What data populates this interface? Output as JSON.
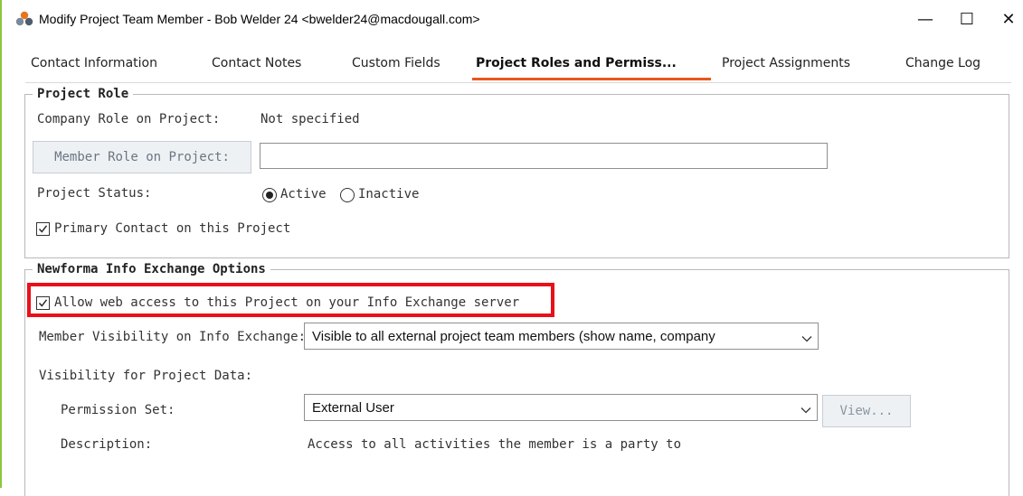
{
  "window": {
    "title": "Modify Project Team Member - Bob Welder 24 <bwelder24@macdougall.com>",
    "controls": {
      "minimize": "—",
      "maximize": "☐",
      "close": "✕"
    }
  },
  "tabs": [
    {
      "label": "Contact Information"
    },
    {
      "label": "Contact Notes"
    },
    {
      "label": "Custom Fields"
    },
    {
      "label": "Project Roles and Permiss..."
    },
    {
      "label": "Project Assignments"
    },
    {
      "label": "Change Log"
    }
  ],
  "active_tab": "Project Roles and Permiss...",
  "project_role": {
    "legend": "Project Role",
    "company_role_label": "Company Role on Project:",
    "company_role_value": "Not specified",
    "member_role_button": "Member Role on Project:",
    "member_role_value": "",
    "status_label": "Project Status:",
    "status_active": "Active",
    "status_inactive": "Inactive",
    "status_selected": "Active",
    "primary_contact_label": "Primary Contact on this Project",
    "primary_contact_checked": true
  },
  "info_exchange": {
    "legend": "Newforma Info Exchange Options",
    "allow_web_access_label": "Allow web access to this Project on your Info Exchange server",
    "allow_web_access_checked": true,
    "member_visibility_label": "Member Visibility on Info Exchange:",
    "member_visibility_value": "Visible to all external project team members (show name, company",
    "visibility_data_label": "Visibility for Project Data:",
    "permission_set_label": "Permission Set:",
    "permission_set_value": "External User",
    "view_button": "View...",
    "description_label": "Description:",
    "description_value": "Access to all activities the member is a party to"
  },
  "colors": {
    "tab_accent": "#e8551c",
    "highlight_box": "#e8101a",
    "left_accent": "#8cc63f"
  }
}
